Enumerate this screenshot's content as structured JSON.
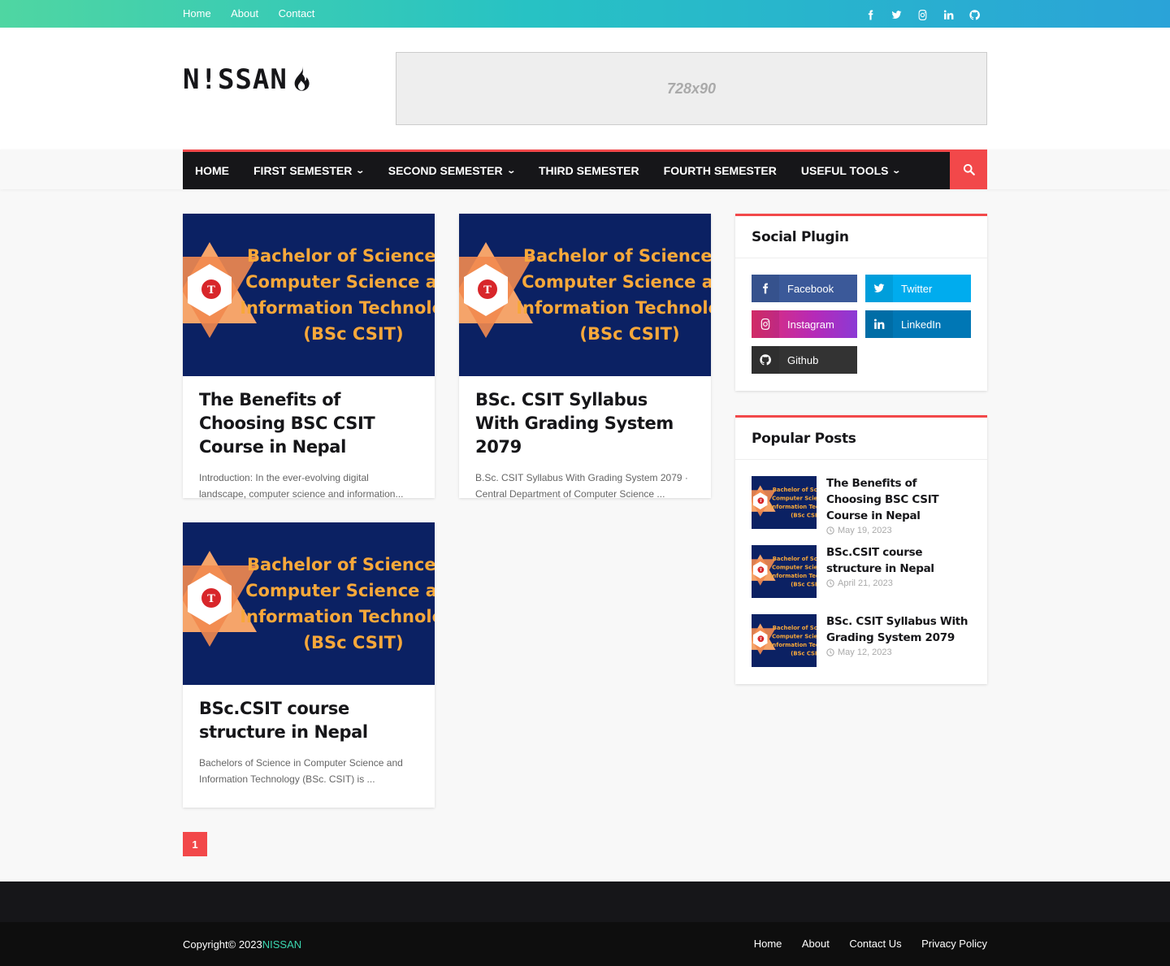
{
  "topbar": {
    "links": [
      "Home",
      "About",
      "Contact"
    ],
    "social_icons": [
      "facebook-icon",
      "twitter-icon",
      "instagram-icon",
      "linkedin-icon",
      "github-icon"
    ]
  },
  "header": {
    "logo_text": "N!SSAN",
    "ad_label": "728x90"
  },
  "nav": {
    "items": [
      {
        "label": "Home",
        "dropdown": false
      },
      {
        "label": "First Semester",
        "dropdown": true
      },
      {
        "label": "Second Semester",
        "dropdown": true
      },
      {
        "label": "Third Semester",
        "dropdown": false
      },
      {
        "label": "Fourth Semester",
        "dropdown": false
      },
      {
        "label": "Useful Tools",
        "dropdown": true
      }
    ],
    "search_icon": "search-icon"
  },
  "thumbnail": {
    "lines": [
      "Bachelor of Science in",
      "Computer Science and",
      "Information Technology",
      "(BSc CSIT)"
    ],
    "bg_color": "#0b2163",
    "text_color": "#f8a83a"
  },
  "posts": [
    {
      "title": "The Benefits of Choosing BSC CSIT Course in Nepal",
      "snippet": "Introduction: In the ever-evolving digital landscape, computer science and information..."
    },
    {
      "title": "BSc. CSIT Syllabus With Grading System 2079",
      "snippet": "B.Sc. CSIT Syllabus With Grading System 2079 · Central Department of Computer Science ..."
    },
    {
      "title": "BSc.CSIT course structure in Nepal",
      "snippet": "Bachelors of Science in Computer Science and Information Technology (BSc. CSIT) is ..."
    }
  ],
  "pagination": {
    "current": "1"
  },
  "sidebar": {
    "social_title": "Social Plugin",
    "social": [
      {
        "label": "Facebook",
        "icon": "facebook-icon",
        "color": "#3b5999"
      },
      {
        "label": "Twitter",
        "icon": "twitter-icon",
        "color": "#00acee"
      },
      {
        "label": "Instagram",
        "icon": "instagram-icon",
        "color": "#c13584"
      },
      {
        "label": "LinkedIn",
        "icon": "linkedin-icon",
        "color": "#0077b5"
      },
      {
        "label": "Github",
        "icon": "github-icon",
        "color": "#333333"
      }
    ],
    "popular_title": "Popular Posts",
    "popular": [
      {
        "title": "The Benefits of Choosing BSC CSIT Course in Nepal",
        "date": "May 19, 2023"
      },
      {
        "title": "BSc.CSIT course structure in Nepal",
        "date": "April 21, 2023"
      },
      {
        "title": "BSc. CSIT Syllabus With Grading System 2079",
        "date": "May 12, 2023"
      }
    ]
  },
  "footer": {
    "copyright": "Copyright© 2023",
    "brand": "NISSAN",
    "links": [
      "Home",
      "About",
      "Contact Us",
      "Privacy Policy"
    ]
  },
  "colors": {
    "accent": "#f2484a",
    "dark": "#161619",
    "brand": "#3bd6b0"
  }
}
